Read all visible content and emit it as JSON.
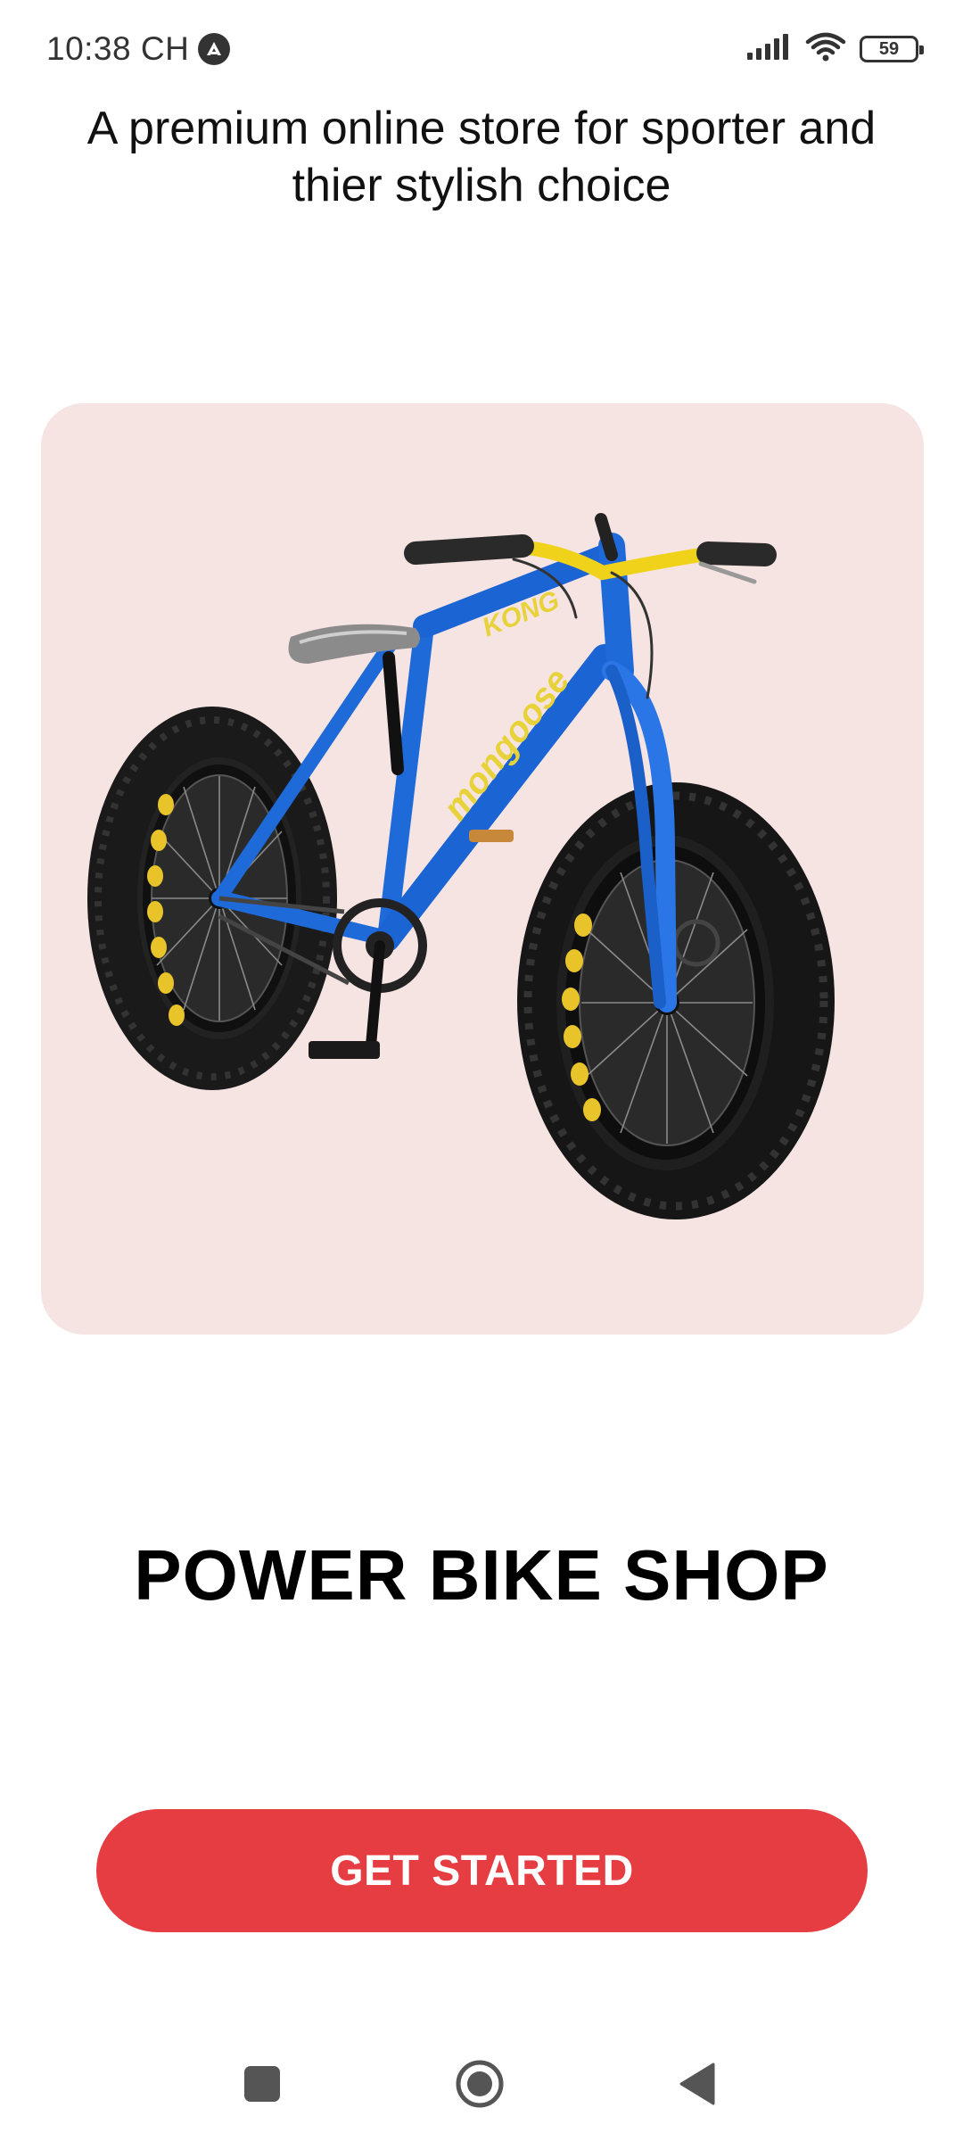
{
  "status_bar": {
    "time": "10:38 CH",
    "battery": "59",
    "icons": [
      "app-notification-icon",
      "signal-icon",
      "wifi-icon",
      "battery-icon"
    ]
  },
  "tagline": "A premium online store for sporter and thier stylish choice",
  "hero": {
    "image": "blue-fat-tire-bike-image",
    "bike_text_1": "KONG",
    "bike_text_2": "mongoose",
    "background_color": "#f6e4e3"
  },
  "title": "POWER BIKE SHOP",
  "cta": {
    "label": "GET STARTED",
    "color": "#e53d42"
  },
  "nav_bar": {
    "icons": [
      "recents-square-icon",
      "home-circle-icon",
      "back-triangle-icon"
    ]
  }
}
